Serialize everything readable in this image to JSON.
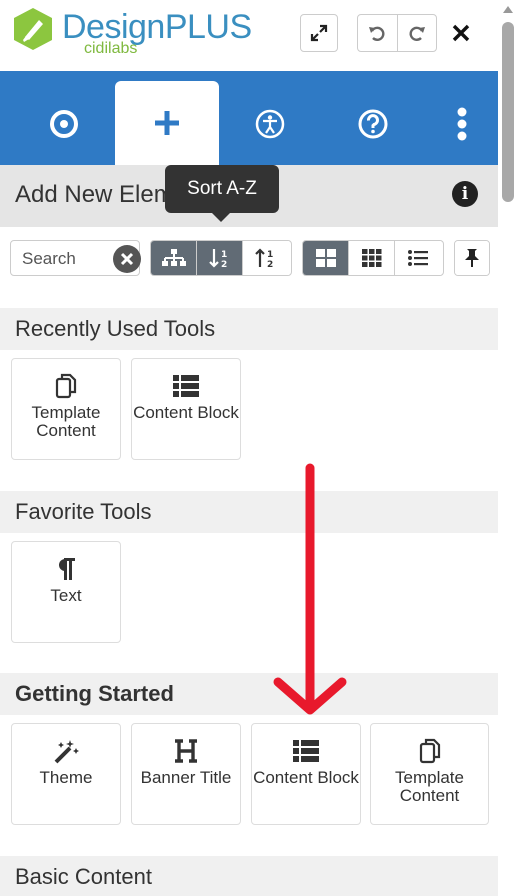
{
  "app": {
    "brand_name": "DesignPLUS",
    "brand_sub": "cidilabs"
  },
  "header": {
    "expand_icon": "expand-arrows-icon",
    "undo_icon": "undo-icon",
    "redo_icon": "redo-icon",
    "close_icon": "close-icon"
  },
  "tabs": [
    {
      "icon": "target-icon",
      "active": false
    },
    {
      "icon": "plus-icon",
      "active": true
    },
    {
      "icon": "accessibility-icon",
      "active": false
    },
    {
      "icon": "help-icon",
      "active": false
    },
    {
      "icon": "more-vertical-icon",
      "active": false
    }
  ],
  "panel": {
    "title": "Add New Elements",
    "tooltip": "Sort A-Z",
    "search_placeholder": "Search"
  },
  "sections": {
    "recent": "Recently Used Tools",
    "favorite": "Favorite Tools",
    "getting_started": "Getting Started",
    "basic": "Basic Content"
  },
  "recent_tools": [
    {
      "label": "Template Content",
      "icon": "copy-icon"
    },
    {
      "label": "Content Block",
      "icon": "list-icon"
    }
  ],
  "favorite_tools": [
    {
      "label": "Text",
      "icon": "paragraph-icon"
    }
  ],
  "getting_started_tools": [
    {
      "label": "Theme",
      "icon": "magic-wand-icon"
    },
    {
      "label": "Banner Title",
      "icon": "heading-icon"
    },
    {
      "label": "Content Block",
      "icon": "list-icon"
    },
    {
      "label": "Template Content",
      "icon": "copy-icon"
    }
  ],
  "colors": {
    "accent_blue": "#2f7ac5",
    "brand_blue": "#3a8fc0",
    "brand_green": "#7fb93f",
    "annotation_arrow": "#e8192c"
  }
}
